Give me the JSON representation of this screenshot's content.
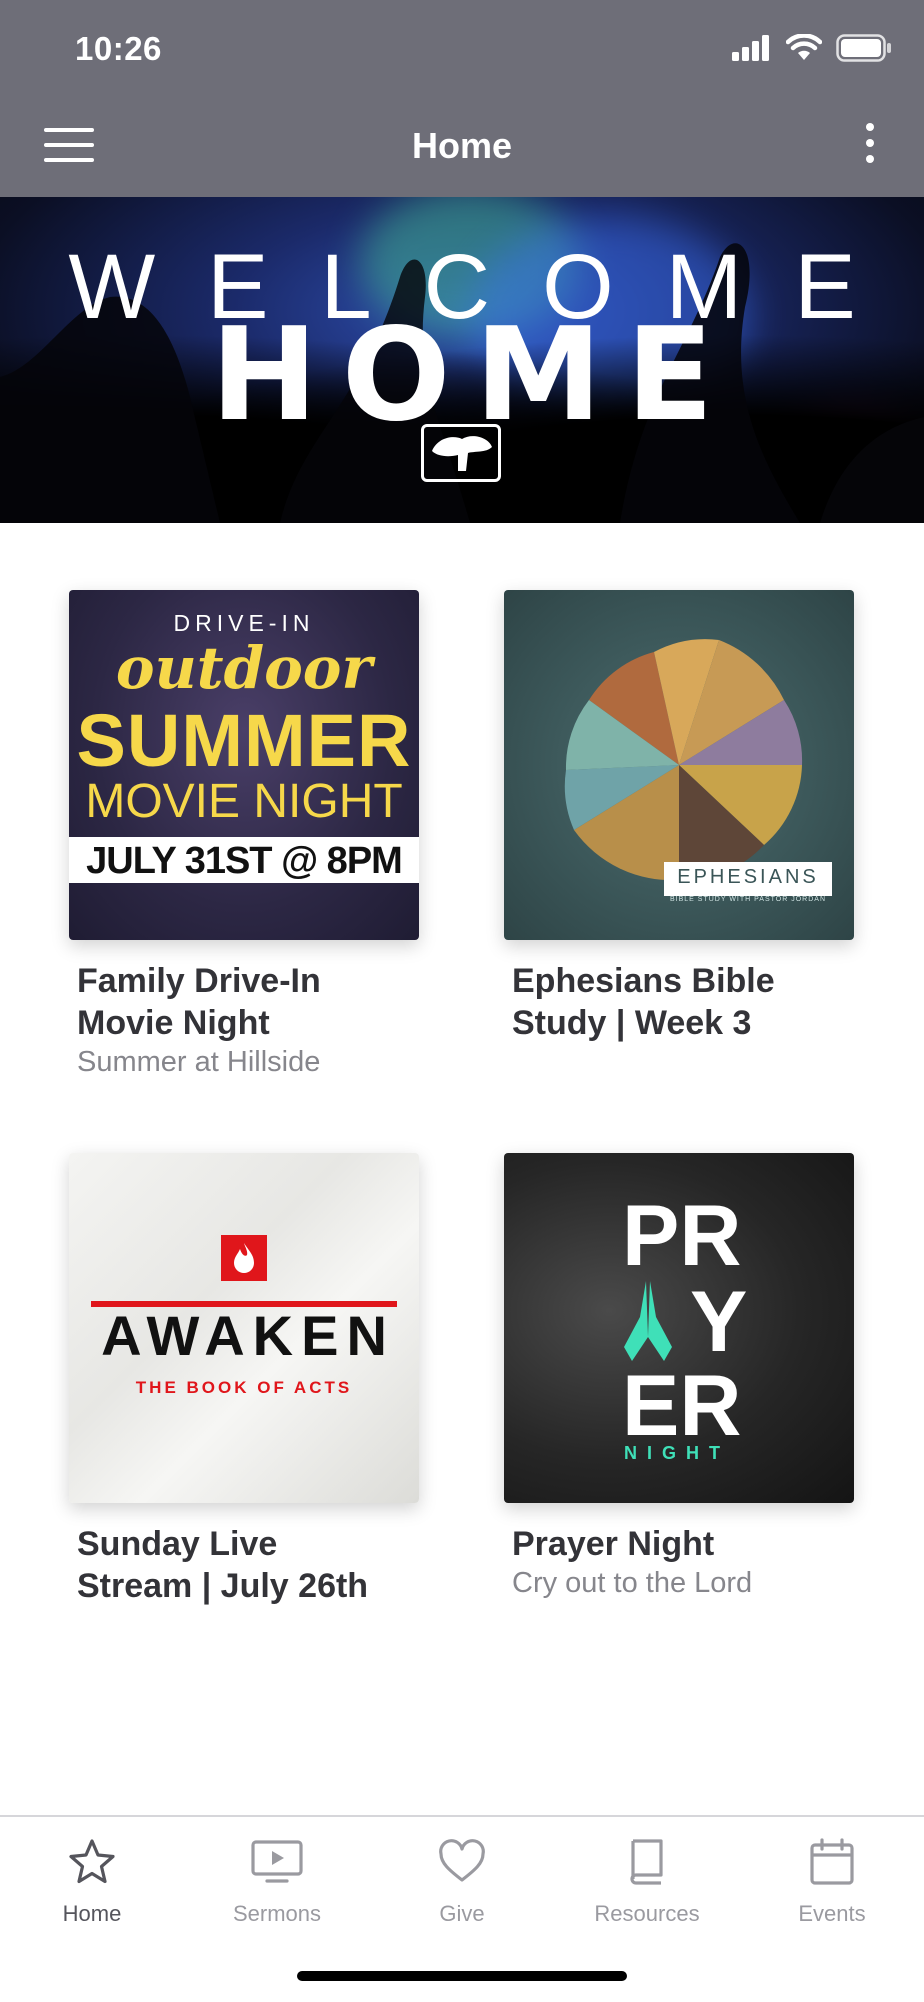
{
  "status_bar": {
    "time": "10:26"
  },
  "nav": {
    "title": "Home"
  },
  "hero": {
    "line1": "WELCOME",
    "line2": "HOME"
  },
  "cards": [
    {
      "title_line1": "Family Drive-In",
      "title_line2": "Movie Night",
      "subtitle": "Summer at Hillside",
      "art": {
        "top": "DRIVE-IN",
        "script": "outdoor",
        "big": "SUMMER",
        "mid": "MOVIE NIGHT",
        "date": "JULY 31ST @ 8PM"
      }
    },
    {
      "title_line1": "Ephesians Bible",
      "title_line2": "Study | Week 3",
      "subtitle": "",
      "art": {
        "label": "EPHESIANS",
        "caption": "BIBLE STUDY WITH PASTOR JORDAN"
      }
    },
    {
      "title_line1": "Sunday Live",
      "title_line2": "Stream | July 26th",
      "subtitle": "",
      "art": {
        "word": "AWAKEN",
        "caption": "THE BOOK OF ACTS"
      }
    },
    {
      "title_line1": "Prayer Night",
      "title_line2": "",
      "subtitle": "Cry out to the Lord",
      "art": {
        "l1": "PR",
        "l2": "Y",
        "l3": "ER",
        "l4": "NIGHT"
      }
    }
  ],
  "tabs": [
    {
      "label": "Home",
      "icon": "star-icon",
      "active": true
    },
    {
      "label": "Sermons",
      "icon": "tv-play-icon",
      "active": false
    },
    {
      "label": "Give",
      "icon": "heart-icon",
      "active": false
    },
    {
      "label": "Resources",
      "icon": "book-icon",
      "active": false
    },
    {
      "label": "Events",
      "icon": "calendar-icon",
      "active": false
    }
  ],
  "colors": {
    "nav_bar": "#6e6e78",
    "title_text": "#333338",
    "subtitle_text": "#86868c",
    "tab_inactive": "#9a9aa0",
    "tab_active": "#55555c",
    "awaken_red": "#e0161b",
    "prayer_mint": "#3fe0b8",
    "movie_yellow": "#f6d84a"
  }
}
